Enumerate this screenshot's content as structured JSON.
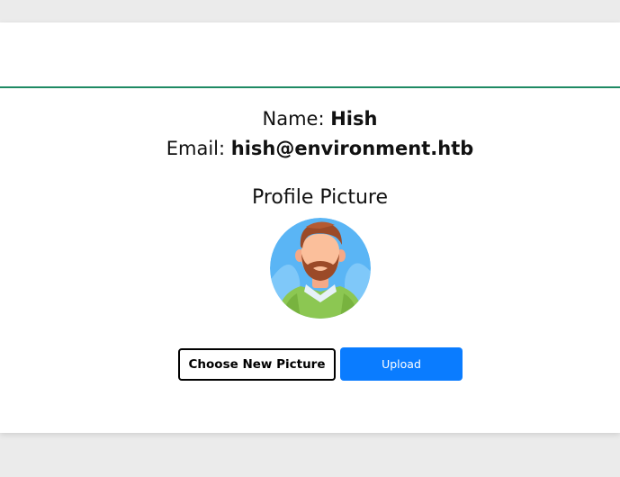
{
  "profile": {
    "name_label": "Name:",
    "name_value": "Hish",
    "email_label": "Email:",
    "email_value": "hish@environment.htb",
    "picture_title": "Profile Picture",
    "avatar_icon": "man-avatar-icon"
  },
  "actions": {
    "choose_label": "Choose New Picture",
    "upload_label": "Upload"
  },
  "colors": {
    "accent_line": "#1e8a63",
    "upload_button": "#0a7cff",
    "page_background": "#ebebeb"
  }
}
